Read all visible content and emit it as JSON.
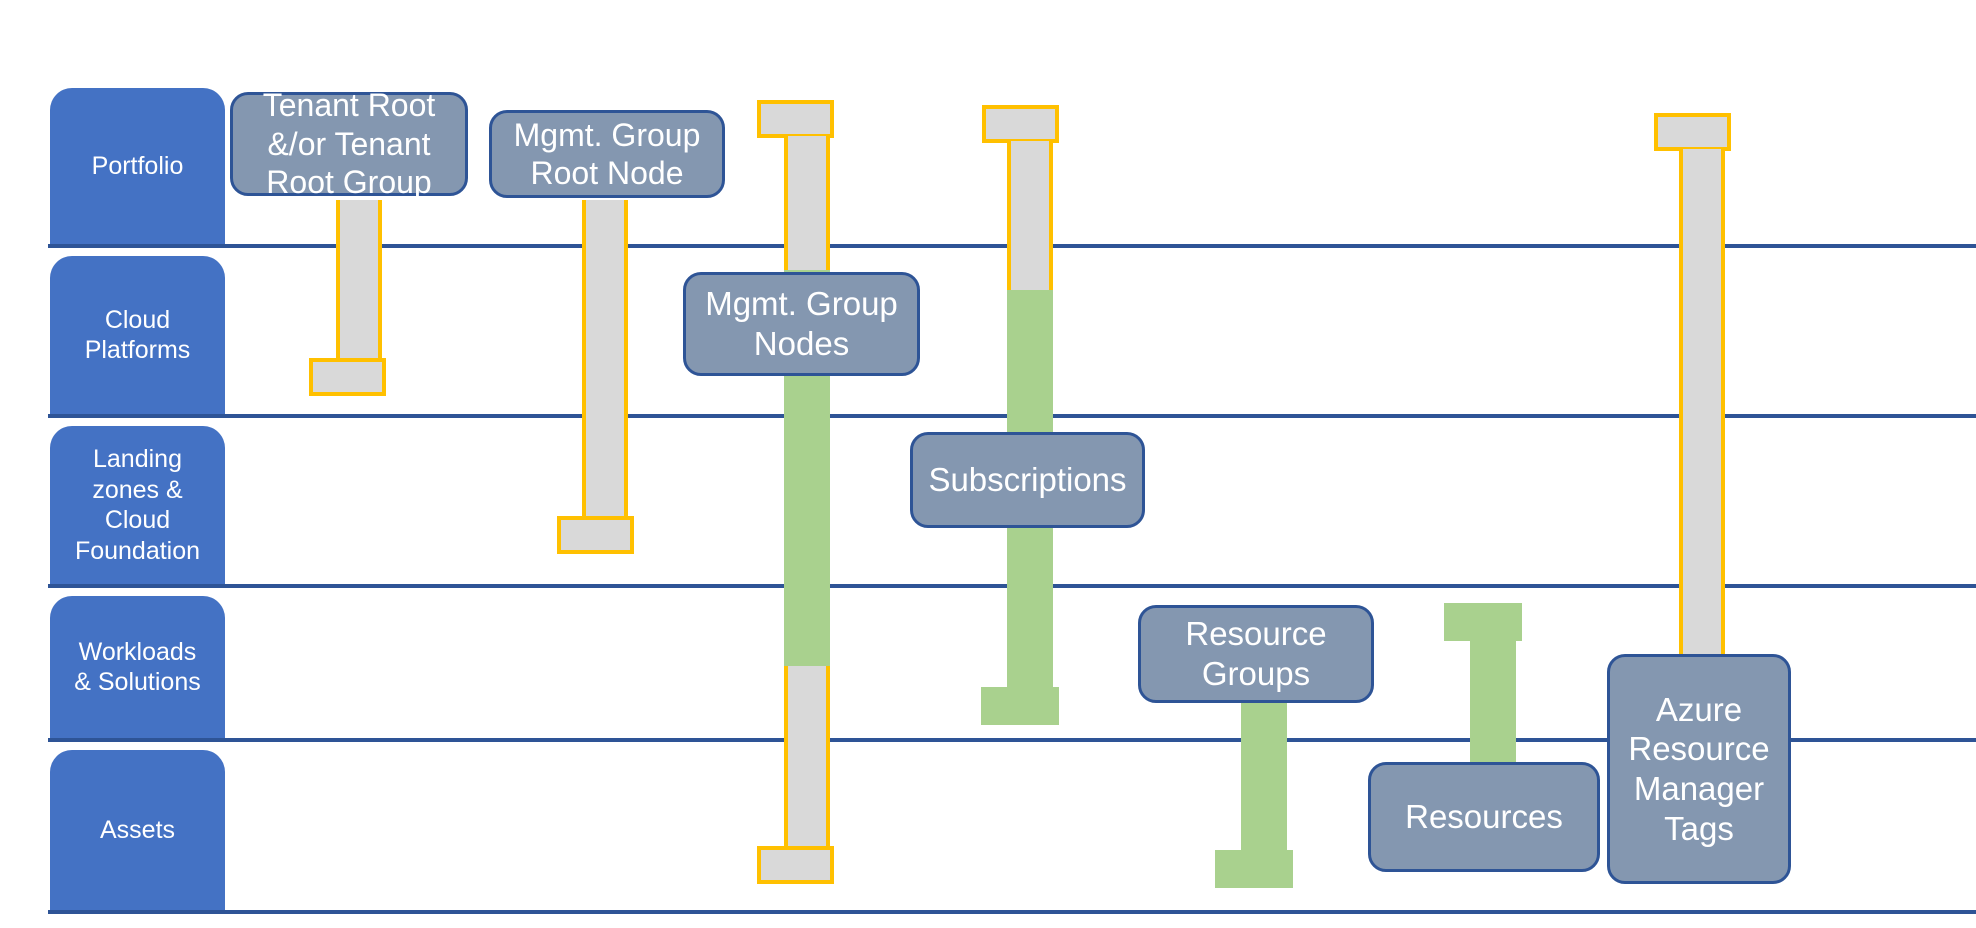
{
  "diagram": {
    "title": "Azure scope hierarchy across cloud adoption layers",
    "colors": {
      "band_label_fill": "#4472C4",
      "band_divider": "#2E5496",
      "node_fill": "#8497B0",
      "node_border": "#2E5496",
      "beam_gray_fill": "#D9D9D9",
      "beam_gray_outline": "#FFC000",
      "beam_green_fill": "#A9D18E",
      "text_on_fill": "#FFFFFF"
    }
  },
  "bands": [
    {
      "id": "portfolio",
      "label": "Portfolio"
    },
    {
      "id": "cloud-platforms",
      "label": "Cloud\nPlatforms"
    },
    {
      "id": "landing-zones",
      "label": "Landing\nzones &\nCloud\nFoundation"
    },
    {
      "id": "workloads",
      "label": "Workloads\n& Solutions"
    },
    {
      "id": "assets",
      "label": "Assets"
    }
  ],
  "nodes": [
    {
      "id": "tenant-root",
      "label": "Tenant Root\n&/or Tenant\nRoot Group",
      "band": "Portfolio"
    },
    {
      "id": "mgmt-group-root",
      "label": "Mgmt. Group\nRoot Node",
      "band": "Portfolio"
    },
    {
      "id": "mgmt-group-nodes",
      "label": "Mgmt. Group\nNodes",
      "band": "Cloud Platforms"
    },
    {
      "id": "subscriptions",
      "label": "Subscriptions",
      "band": "Landing zones & Cloud Foundation"
    },
    {
      "id": "resource-groups",
      "label": "Resource\nGroups",
      "band": "Workloads & Solutions"
    },
    {
      "id": "resources",
      "label": "Resources",
      "band": "Assets"
    },
    {
      "id": "arm-tags",
      "label": "Azure\nResource\nManager\nTags",
      "band": "Workloads & Solutions / Assets"
    }
  ],
  "scope_spans": [
    {
      "id": "tenant-root-span",
      "node": "Tenant Root &/or Tenant Root Group",
      "from_band": "Portfolio",
      "to_band": "Cloud Platforms",
      "style": "gray-outlined"
    },
    {
      "id": "mgmt-group-root-span",
      "node": "Mgmt. Group Root Node",
      "from_band": "Portfolio",
      "to_band": "Landing zones & Cloud Foundation",
      "style": "gray-outlined"
    },
    {
      "id": "mgmt-group-nodes-span",
      "node": "Mgmt. Group Nodes",
      "from_band": "Portfolio",
      "to_band": "Assets",
      "style": "gray-outlined-with-green-middle"
    },
    {
      "id": "subscriptions-span",
      "node": "Subscriptions",
      "from_band": "Portfolio",
      "to_band": "Workloads & Solutions",
      "style": "gray-outlined-with-green-lower"
    },
    {
      "id": "resource-groups-span",
      "node": "Resource Groups",
      "from_band": "Workloads & Solutions",
      "to_band": "Assets",
      "style": "green"
    },
    {
      "id": "resources-span",
      "node": "Resources",
      "from_band": "Workloads & Solutions",
      "to_band": "Assets",
      "style": "green"
    },
    {
      "id": "arm-tags-span",
      "node": "Azure Resource Manager Tags",
      "from_band": "Portfolio",
      "to_band": "Workloads & Solutions",
      "style": "gray-outlined"
    }
  ]
}
